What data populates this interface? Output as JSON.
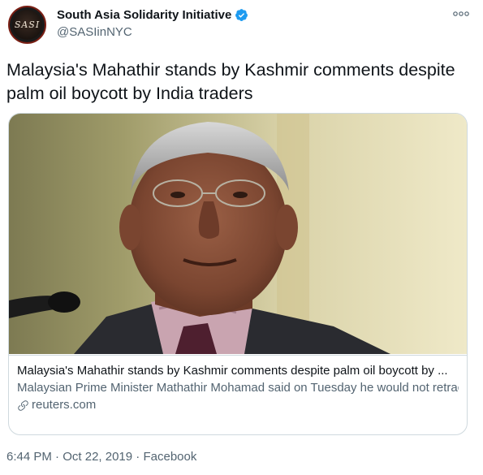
{
  "author": {
    "display_name": "South Asia Solidarity Initiative",
    "handle": "@SASIinNYC",
    "avatar_text": "SASI",
    "verified": true
  },
  "tweet": {
    "text": "Malaysia's Mahathir stands by Kashmir comments despite palm oil boycott by India traders"
  },
  "card": {
    "title": "Malaysia's Mahathir stands by Kashmir comments despite palm oil boycott by ...",
    "description": "Malaysian Prime Minister Mathathir Mohamad said on Tuesday he would not retract his criticism of New Delhi's actions in the disputed region of Kashmir ...",
    "domain": "reuters.com"
  },
  "meta": {
    "time": "6:44 PM",
    "separator": " · ",
    "date": "Oct 22, 2019",
    "source": "Facebook"
  },
  "colors": {
    "verified": "#1d9bf0",
    "secondary_text": "#536471",
    "border": "#cfd9de"
  },
  "icons": [
    "verified-badge-icon",
    "more-options-icon",
    "link-icon"
  ]
}
